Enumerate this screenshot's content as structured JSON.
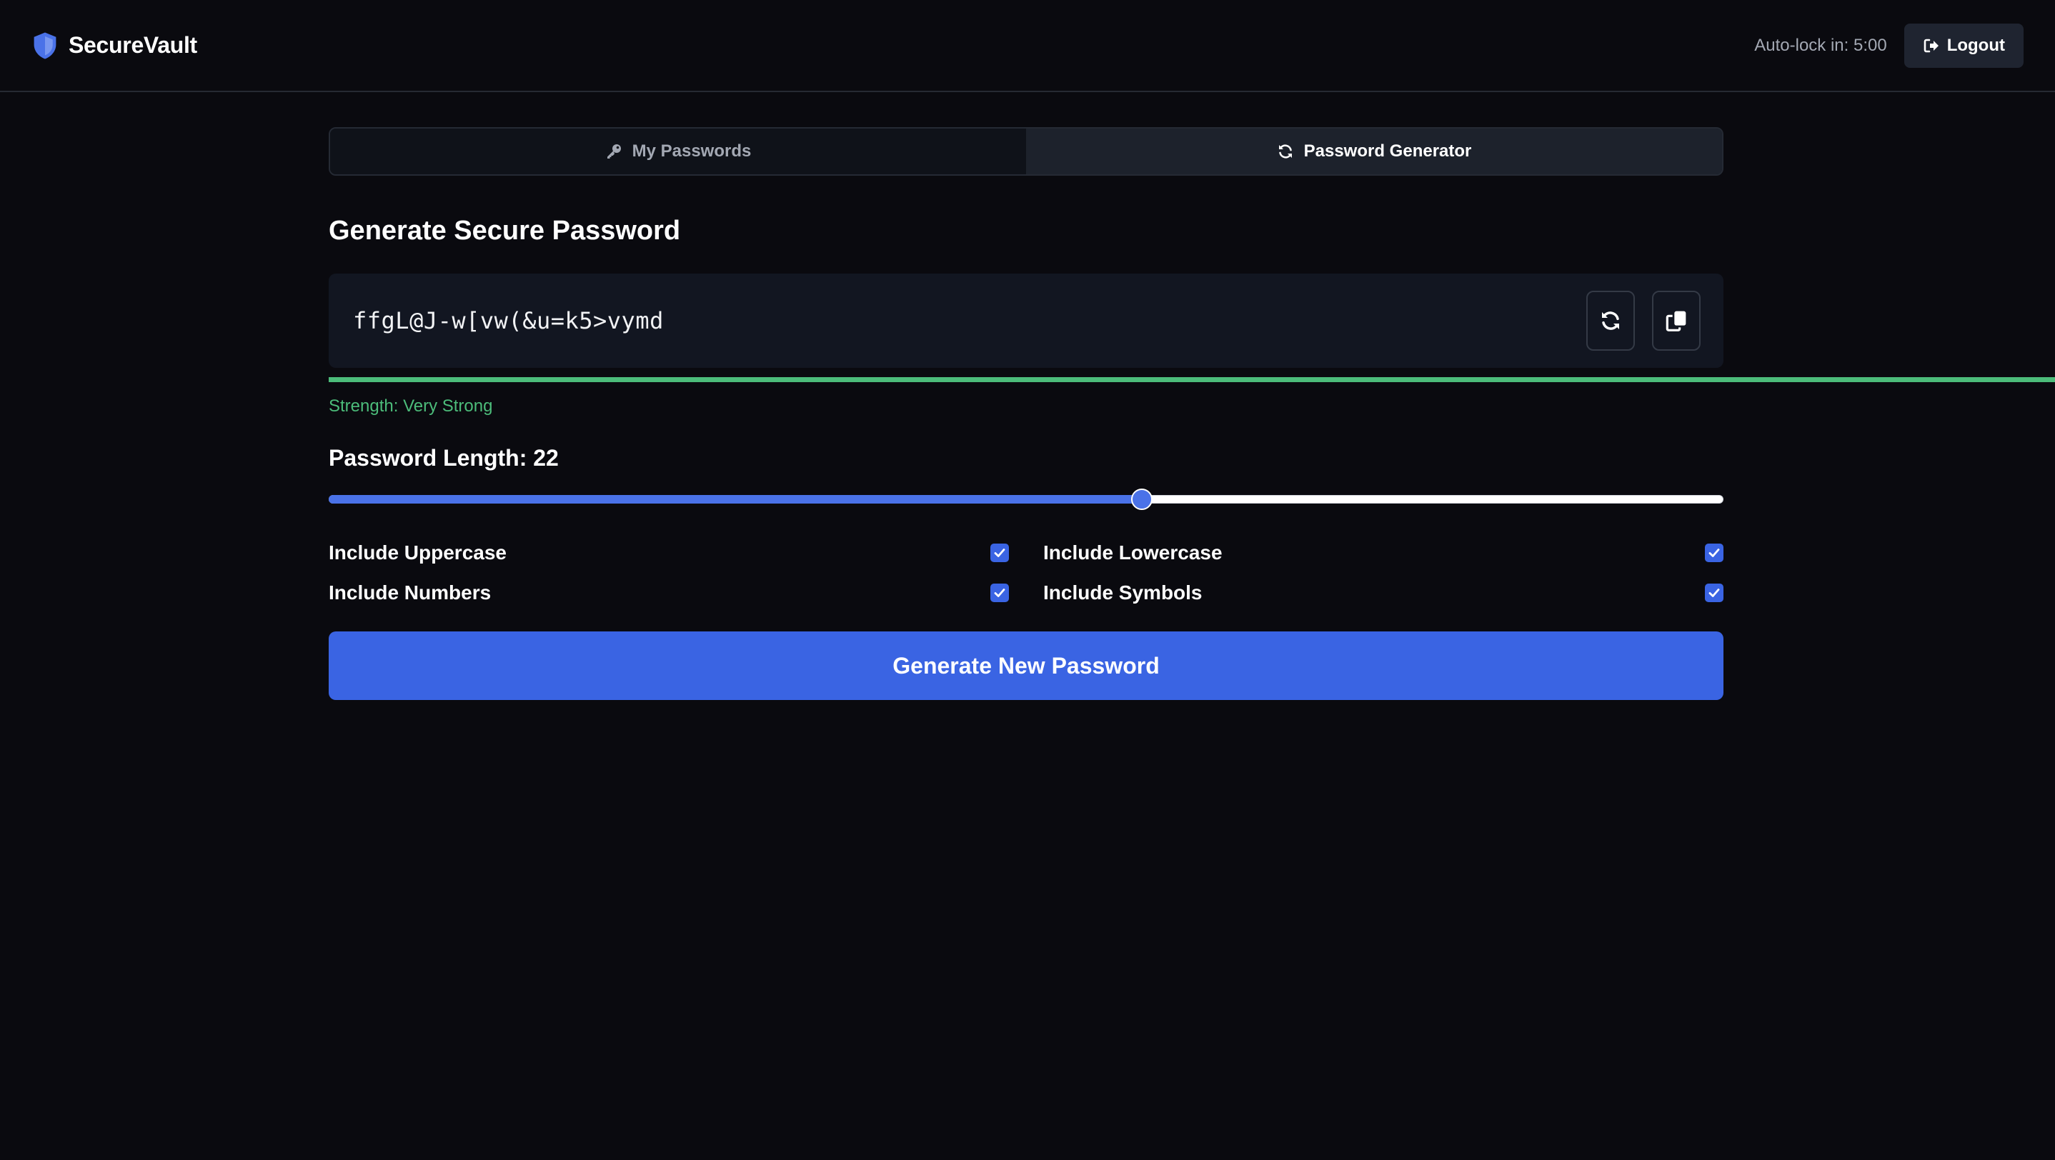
{
  "header": {
    "app_name": "SecureVault",
    "autolock": "Auto-lock in: 5:00",
    "logout_label": "Logout",
    "icons": {
      "brand": "shield-icon",
      "logout": "sign-out-icon"
    }
  },
  "tabs": [
    {
      "label": "My Passwords",
      "icon": "key-icon",
      "active": false
    },
    {
      "label": "Password Generator",
      "icon": "refresh-icon",
      "active": true
    }
  ],
  "generator": {
    "title": "Generate Secure Password",
    "password": "ffgL@J-w[vw(&u=k5>vymd",
    "strength_text": "Strength: Very Strong",
    "length_label": "Password Length: 22",
    "slider_fraction": 0.583,
    "options": [
      {
        "label": "Include Uppercase",
        "checked": true
      },
      {
        "label": "Include Lowercase",
        "checked": true
      },
      {
        "label": "Include Numbers",
        "checked": true
      },
      {
        "label": "Include Symbols",
        "checked": true
      }
    ],
    "generate_label": "Generate New Password"
  },
  "colors": {
    "background": "#0a0a0f",
    "accent": "#3a64e3",
    "strength": "#4cbc7a",
    "shield": "#4a72e8"
  }
}
